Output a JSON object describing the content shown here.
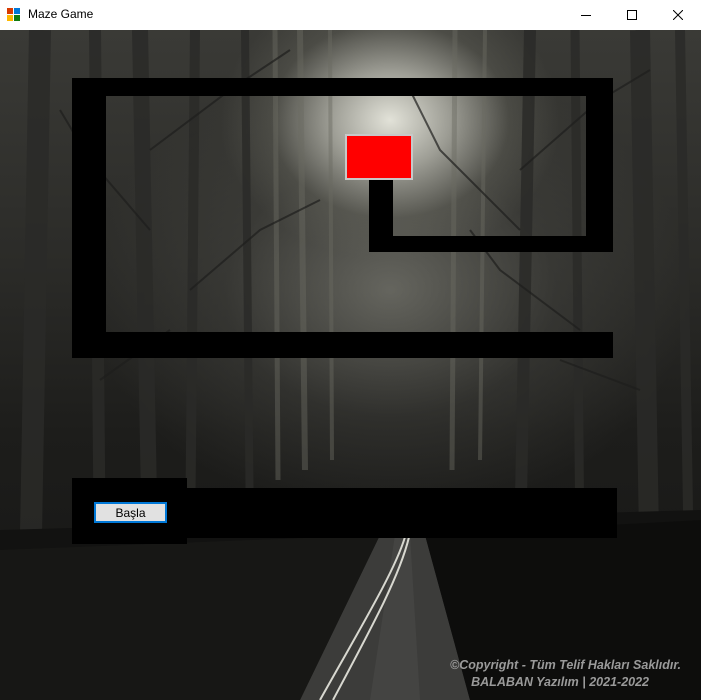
{
  "window": {
    "title": "Maze Game",
    "controls": [
      "minimize-icon",
      "maximize-icon",
      "close-icon"
    ]
  },
  "game": {
    "start_button_label": "Başla",
    "player_color": "#ff0000",
    "wall_color": "#000000"
  },
  "footer": {
    "copyright_line1": "©Copyright  - Tüm Telif Hakları Saklıdır.",
    "copyright_line2": "BALABAN Yazılım | 2021-2022"
  }
}
